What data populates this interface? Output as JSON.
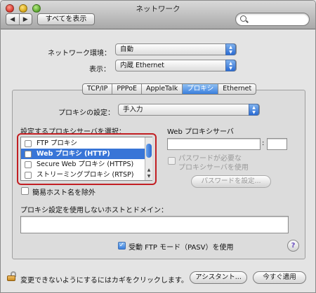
{
  "window": {
    "title": "ネットワーク"
  },
  "toolbar": {
    "back": "◀",
    "forward": "▶",
    "show_all": "すべてを表示",
    "search_placeholder": ""
  },
  "location": {
    "label": "ネットワーク環境：",
    "value": "自動"
  },
  "show": {
    "label": "表示：",
    "value": "内蔵 Ethernet"
  },
  "tabs": [
    "TCP/IP",
    "PPPoE",
    "AppleTalk",
    "プロキシ",
    "Ethernet"
  ],
  "proxy_settings": {
    "label": "プロキシの設定：",
    "value": "手入力"
  },
  "proxy_list": {
    "label": "設定するプロキシサーバを選択：",
    "items": [
      {
        "label": "FTP プロキシ",
        "checked": false,
        "selected": false
      },
      {
        "label": "Web プロキシ (HTTP)",
        "checked": false,
        "selected": true
      },
      {
        "label": "Secure Web プロキシ (HTTPS)",
        "checked": false,
        "selected": false
      },
      {
        "label": "ストリーミングプロキシ (RTSP)",
        "checked": false,
        "selected": false
      }
    ]
  },
  "web_proxy": {
    "label": "Web プロキシサーバ",
    "colon": ":",
    "password_required": "パスワードが必要な\nプロキシサーバを使用",
    "set_password": "パスワードを設定..."
  },
  "exclude_simple": "簡易ホスト名を除外",
  "bypass_label": "プロキシ設定を使用しないホストとドメイン：",
  "passive_ftp": "受動 FTP モード（PASV）を使用",
  "help": "?",
  "footer": {
    "lock_text": "変更できないようにするにはカギをクリックします。",
    "assistant": "アシスタント...",
    "apply": "今すぐ適用"
  },
  "colors": {
    "accent": "#3875d7",
    "highlight": "#c21f23"
  }
}
